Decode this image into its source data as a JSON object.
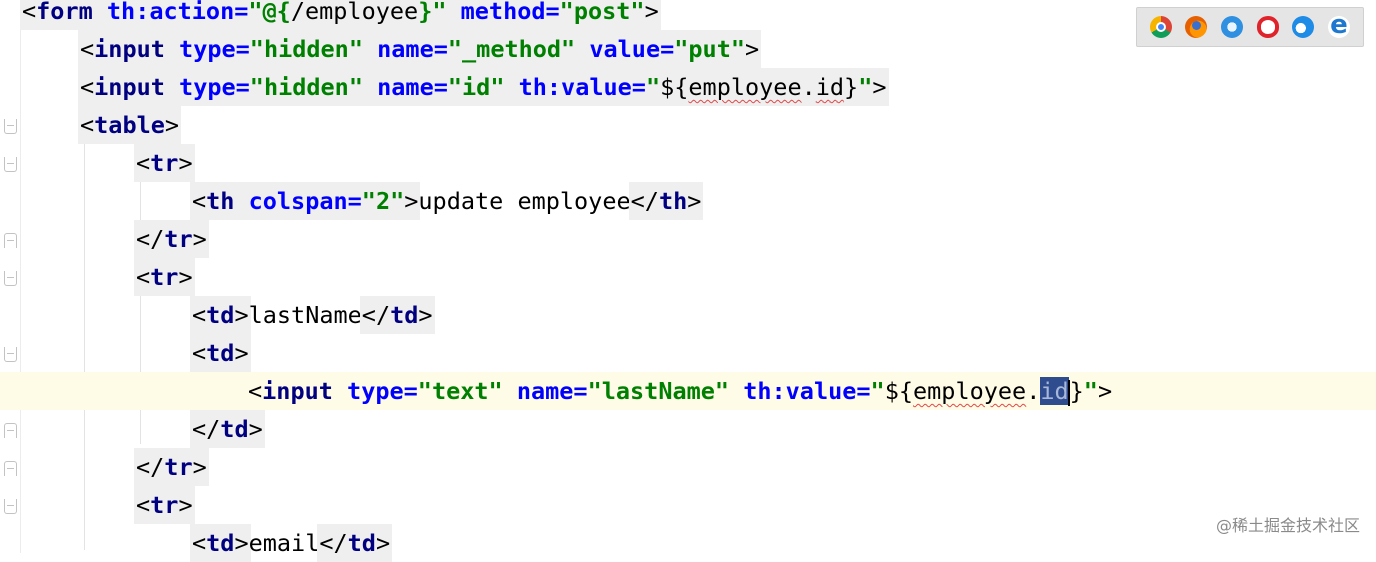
{
  "editor": {
    "lines": [
      {
        "segments": [
          {
            "t": "<",
            "c": "txt"
          },
          {
            "t": "form",
            "c": "kw"
          },
          {
            "t": " th:action=",
            "c": "attr"
          },
          {
            "t": "\"@{",
            "c": "str"
          },
          {
            "t": "/employee",
            "c": "txt"
          },
          {
            "t": "}\"",
            "c": "str"
          },
          {
            "t": " method=",
            "c": "attr"
          },
          {
            "t": "\"post\"",
            "c": "str"
          },
          {
            "t": ">",
            "c": "txt"
          }
        ]
      },
      {
        "segments": [
          {
            "t": "<",
            "c": "txt"
          },
          {
            "t": "input",
            "c": "kw"
          },
          {
            "t": " type=",
            "c": "attr"
          },
          {
            "t": "\"hidden\"",
            "c": "str"
          },
          {
            "t": " name=",
            "c": "attr"
          },
          {
            "t": "\"_method\"",
            "c": "str"
          },
          {
            "t": " value=",
            "c": "attr"
          },
          {
            "t": "\"put\"",
            "c": "str"
          },
          {
            "t": ">",
            "c": "txt"
          }
        ]
      },
      {
        "segments": [
          {
            "t": "<",
            "c": "txt"
          },
          {
            "t": "input",
            "c": "kw"
          },
          {
            "t": " type=",
            "c": "attr"
          },
          {
            "t": "\"hidden\"",
            "c": "str"
          },
          {
            "t": " name=",
            "c": "attr"
          },
          {
            "t": "\"id\"",
            "c": "str"
          },
          {
            "t": " th:value=",
            "c": "attr"
          },
          {
            "t": "\"",
            "c": "str"
          },
          {
            "t": "${",
            "c": "txt"
          },
          {
            "t": "employee",
            "c": "txt typo"
          },
          {
            "t": ".",
            "c": "txt"
          },
          {
            "t": "id",
            "c": "txt typo"
          },
          {
            "t": "}",
            "c": "txt"
          },
          {
            "t": "\"",
            "c": "str"
          },
          {
            "t": ">",
            "c": "txt"
          }
        ]
      },
      {
        "segments": [
          {
            "t": "<",
            "c": "txt"
          },
          {
            "t": "table",
            "c": "kw"
          },
          {
            "t": ">",
            "c": "txt"
          }
        ]
      },
      {
        "segments": [
          {
            "t": "<",
            "c": "txt"
          },
          {
            "t": "tr",
            "c": "kw"
          },
          {
            "t": ">",
            "c": "txt"
          }
        ]
      },
      {
        "segments": [
          {
            "t": "<",
            "c": "txt"
          },
          {
            "t": "th",
            "c": "kw"
          },
          {
            "t": " colspan=",
            "c": "attr"
          },
          {
            "t": "\"2\"",
            "c": "str"
          },
          {
            "t": ">",
            "c": "txt"
          },
          {
            "t": "update employee",
            "c": "txt plain"
          },
          {
            "t": "</",
            "c": "txt"
          },
          {
            "t": "th",
            "c": "kw"
          },
          {
            "t": ">",
            "c": "txt"
          }
        ]
      },
      {
        "segments": [
          {
            "t": "</",
            "c": "txt"
          },
          {
            "t": "tr",
            "c": "kw"
          },
          {
            "t": ">",
            "c": "txt"
          }
        ]
      },
      {
        "segments": [
          {
            "t": "<",
            "c": "txt"
          },
          {
            "t": "tr",
            "c": "kw"
          },
          {
            "t": ">",
            "c": "txt"
          }
        ]
      },
      {
        "segments": [
          {
            "t": "<",
            "c": "txt"
          },
          {
            "t": "td",
            "c": "kw"
          },
          {
            "t": ">",
            "c": "txt"
          },
          {
            "t": "lastName",
            "c": "txt plain"
          },
          {
            "t": "</",
            "c": "txt"
          },
          {
            "t": "td",
            "c": "kw"
          },
          {
            "t": ">",
            "c": "txt"
          }
        ]
      },
      {
        "segments": [
          {
            "t": "<",
            "c": "txt"
          },
          {
            "t": "td",
            "c": "kw"
          },
          {
            "t": ">",
            "c": "txt"
          }
        ]
      },
      {
        "segments": [
          {
            "t": "<",
            "c": "txt"
          },
          {
            "t": "input",
            "c": "kw"
          },
          {
            "t": " type=",
            "c": "attr"
          },
          {
            "t": "\"text\"",
            "c": "str"
          },
          {
            "t": " name=",
            "c": "attr"
          },
          {
            "t": "\"lastName\"",
            "c": "str"
          },
          {
            "t": " th:value=",
            "c": "attr"
          },
          {
            "t": "\"",
            "c": "str"
          },
          {
            "t": "${",
            "c": "txt"
          },
          {
            "t": "employee",
            "c": "txt typo"
          },
          {
            "t": ".",
            "c": "txt"
          },
          {
            "t": "id",
            "c": "txt sel"
          },
          {
            "t": "}",
            "c": "txt"
          },
          {
            "t": "\"",
            "c": "str"
          },
          {
            "t": ">",
            "c": "txt"
          }
        ]
      },
      {
        "segments": [
          {
            "t": "</",
            "c": "txt"
          },
          {
            "t": "td",
            "c": "kw"
          },
          {
            "t": ">",
            "c": "txt"
          }
        ]
      },
      {
        "segments": [
          {
            "t": "</",
            "c": "txt"
          },
          {
            "t": "tr",
            "c": "kw"
          },
          {
            "t": ">",
            "c": "txt"
          }
        ]
      },
      {
        "segments": [
          {
            "t": "<",
            "c": "txt"
          },
          {
            "t": "tr",
            "c": "kw"
          },
          {
            "t": ">",
            "c": "txt"
          }
        ]
      },
      {
        "segments": [
          {
            "t": "<",
            "c": "txt"
          },
          {
            "t": "td",
            "c": "kw"
          },
          {
            "t": ">",
            "c": "txt"
          },
          {
            "t": "email",
            "c": "txt plain"
          },
          {
            "t": "</",
            "c": "txt"
          },
          {
            "t": "td",
            "c": "kw"
          },
          {
            "t": ">",
            "c": "txt"
          }
        ]
      }
    ]
  },
  "browser_bar": {
    "icons": [
      "chrome-icon",
      "firefox-icon",
      "safari-icon",
      "opera-icon",
      "edge-icon",
      "internet-explorer-icon"
    ]
  },
  "watermark": "@稀土掘金技术社区"
}
